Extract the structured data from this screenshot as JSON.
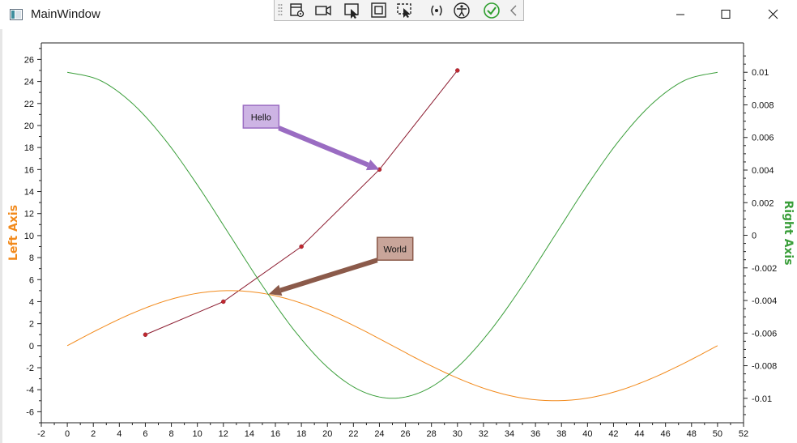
{
  "window": {
    "title": "MainWindow",
    "controls": [
      "minimize-button",
      "maximize-button",
      "close-button"
    ]
  },
  "debug_toolbar": {
    "buttons": [
      "select-element-icon",
      "video-icon",
      "pointer-icon",
      "frame-icon",
      "element-select-icon",
      "binding-icon",
      "accessibility-icon",
      "check-icon",
      "collapse-icon"
    ],
    "colors": {
      "check": "#2e9e2e"
    }
  },
  "chart_data": {
    "type": "line",
    "title": "",
    "xlabel": "",
    "ylabel": "Left Axis",
    "y2label": "Right Axis",
    "xlim": [
      -2,
      52
    ],
    "ylim": [
      -7,
      27.5
    ],
    "y2lim": [
      -0.0115,
      0.0118
    ],
    "x_ticks": [
      -2,
      0,
      2,
      4,
      6,
      8,
      10,
      12,
      14,
      16,
      18,
      20,
      22,
      24,
      26,
      28,
      30,
      32,
      34,
      36,
      38,
      40,
      42,
      44,
      46,
      48,
      50,
      52
    ],
    "y_ticks": [
      -6,
      -4,
      -2,
      0,
      2,
      4,
      6,
      8,
      10,
      12,
      14,
      16,
      18,
      20,
      22,
      24,
      26
    ],
    "y2_ticks": [
      {
        "value": -0.01,
        "label": "-0.01"
      },
      {
        "value": -0.008,
        "label": "-0.008"
      },
      {
        "value": -0.006,
        "label": "-0.006"
      },
      {
        "value": -0.004,
        "label": "-0.004"
      },
      {
        "value": -0.002,
        "label": "-0.002"
      },
      {
        "value": 0,
        "label": "0"
      },
      {
        "value": 0.002,
        "label": "0.002"
      },
      {
        "value": 0.004,
        "label": "0.004"
      },
      {
        "value": 0.006,
        "label": "0.006"
      },
      {
        "value": 0.008,
        "label": "0.008"
      },
      {
        "value": 0.01,
        "label": "0.01"
      }
    ],
    "series": [
      {
        "axis": "left",
        "color": "#8b1a2e",
        "markers": true,
        "x": [
          6,
          12,
          18,
          24,
          30
        ],
        "y": [
          1,
          4,
          9,
          16,
          25
        ]
      },
      {
        "axis": "left",
        "color": "#f28a1c",
        "markers": false,
        "x": [
          0,
          2.5,
          5,
          7.5,
          10,
          12.5,
          15,
          17.5,
          20,
          22.5,
          25,
          27.5,
          30,
          32.5,
          35,
          37.5,
          40,
          42.5,
          45,
          47.5,
          50
        ],
        "y": [
          0,
          1.55,
          2.94,
          4.05,
          4.76,
          5.0,
          4.76,
          4.05,
          2.94,
          1.55,
          0,
          -1.55,
          -2.94,
          -4.05,
          -4.76,
          -5.0,
          -4.76,
          -4.05,
          -2.94,
          -1.55,
          0
        ]
      },
      {
        "axis": "right",
        "color": "#3a9e3a",
        "markers": false,
        "x": [
          0,
          2.5,
          5,
          7.5,
          10,
          12.5,
          15,
          17.5,
          20,
          22.5,
          25,
          27.5,
          30,
          32.5,
          35,
          37.5,
          40,
          42.5,
          45,
          47.5,
          50
        ],
        "y": [
          0.01,
          0.00951,
          0.00809,
          0.00588,
          0.00309,
          0,
          -0.00309,
          -0.00588,
          -0.00809,
          -0.00951,
          -0.01,
          -0.00951,
          -0.00809,
          -0.00588,
          -0.00309,
          0,
          0.00309,
          0.00588,
          0.00809,
          0.00951,
          0.01
        ]
      }
    ],
    "annotations": [
      {
        "text": "Hello",
        "fill": "#cdb4e4",
        "stroke": "#9a6cc2",
        "arrow_color": "#9a6cc2",
        "text_at": {
          "x": 14.9,
          "y": 20.8
        },
        "points_to": {
          "x": 24,
          "y": 16
        }
      },
      {
        "text": "World",
        "fill": "#c9a59a",
        "stroke": "#8b5a4a",
        "arrow_color": "#8b5a4a",
        "text_at": {
          "x": 25.2,
          "y": 8.8
        },
        "points_to": {
          "x": 15.5,
          "y": 4.7
        }
      }
    ],
    "colors": {
      "left_axis_title": "#f28a1c",
      "right_axis_title": "#3a9e3a",
      "axis": "#222222"
    },
    "grid": false,
    "legend": "none"
  }
}
